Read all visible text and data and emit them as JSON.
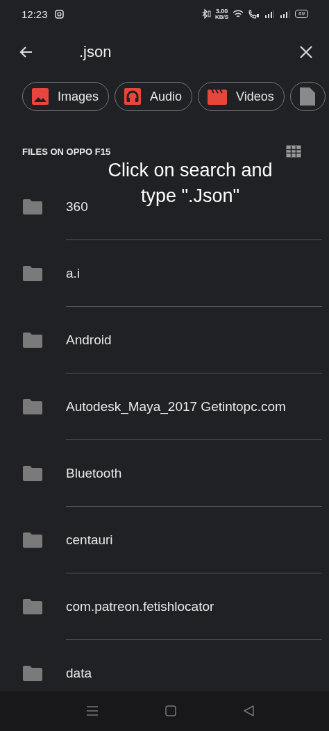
{
  "status_bar": {
    "time": "12:23",
    "net_speed": "3.00",
    "net_unit": "KB/S",
    "battery": "69"
  },
  "search": {
    "value": ".json"
  },
  "chips": [
    {
      "label": "Images",
      "kind": "images"
    },
    {
      "label": "Audio",
      "kind": "audio"
    },
    {
      "label": "Videos",
      "kind": "videos"
    },
    {
      "kind": "documents"
    }
  ],
  "section": {
    "title": "FILES ON OPPO F15"
  },
  "caption": "Click on search and type \".Json\"",
  "folders": [
    {
      "name": "360"
    },
    {
      "name": "a.i"
    },
    {
      "name": "Android"
    },
    {
      "name": "Autodesk_Maya_2017 Getintopc.com"
    },
    {
      "name": "Bluetooth"
    },
    {
      "name": "centauri"
    },
    {
      "name": "com.patreon.fetishlocator"
    },
    {
      "name": "data"
    }
  ]
}
